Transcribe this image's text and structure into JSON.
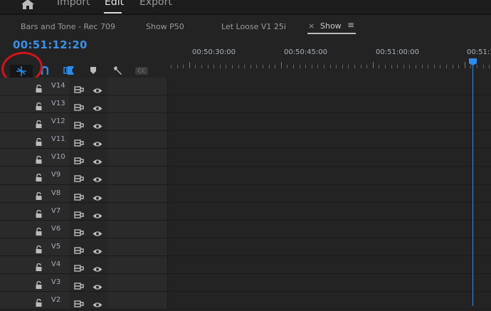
{
  "topnav": {
    "items": [
      "Import",
      "Edit",
      "Export"
    ],
    "active": "Edit"
  },
  "tabs": [
    "Bars and Tone - Rec 709",
    "Show P50",
    "Let Loose V1 25i",
    "Show"
  ],
  "active_tab": "Show",
  "timecode": "00:51:12:20",
  "ruler_labels": [
    "00:50:30:00",
    "00:50:45:00",
    "00:51:00:00",
    "00:51:1"
  ],
  "tools": {
    "cc": "CC"
  },
  "tracks": [
    "V14",
    "V13",
    "V12",
    "V11",
    "V10",
    "V9",
    "V8",
    "V7",
    "V6",
    "V5",
    "V4",
    "V3",
    "V2"
  ],
  "colors": {
    "accent": "#2d8ceb",
    "annotation": "#d4131b"
  }
}
